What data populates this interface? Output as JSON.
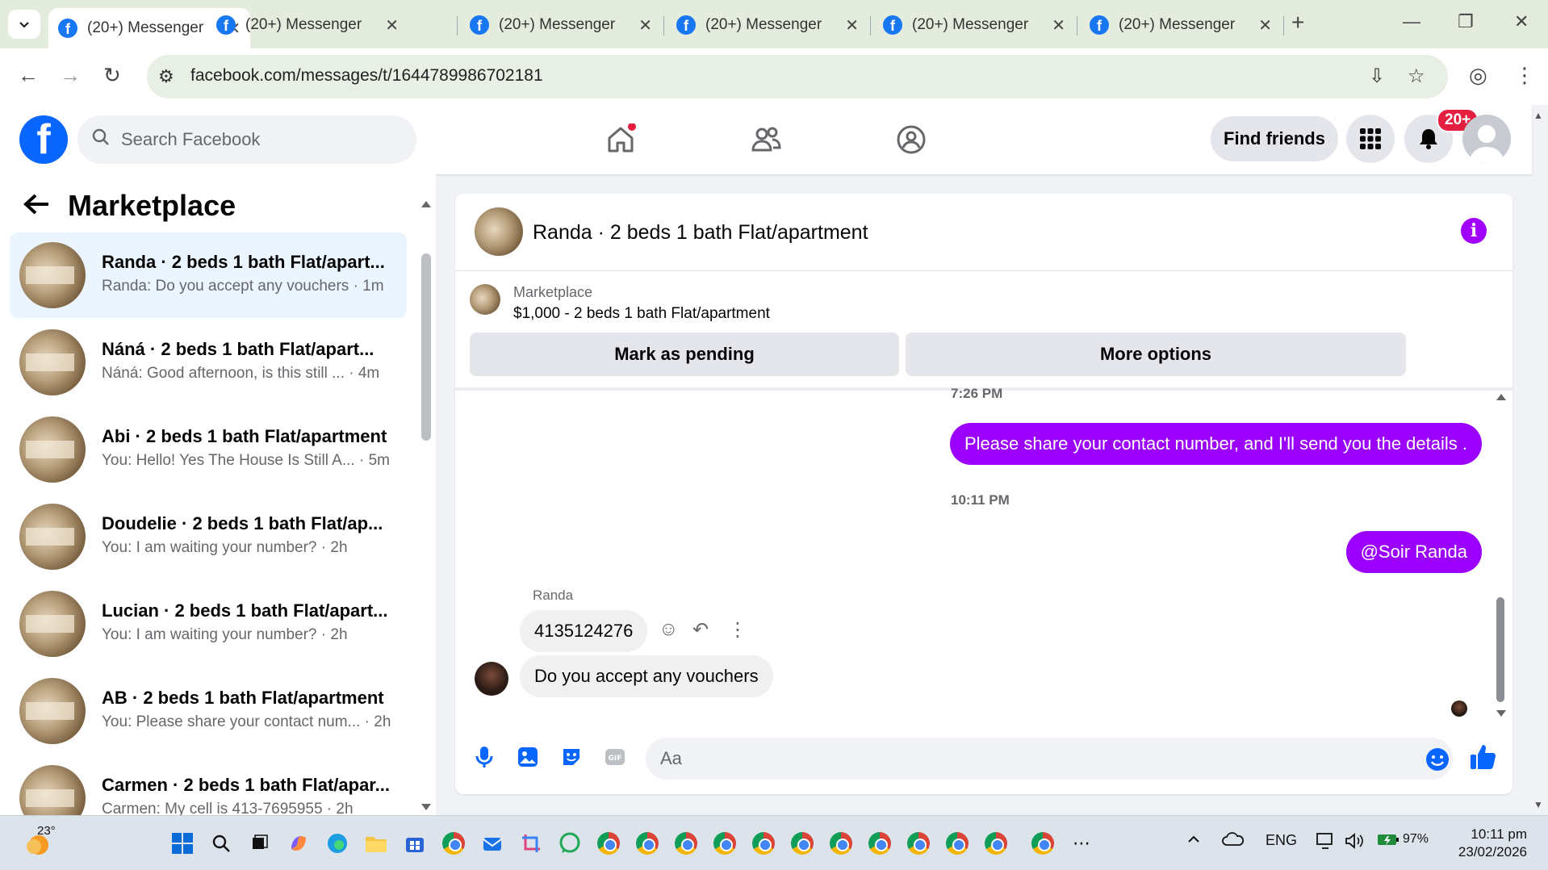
{
  "browser": {
    "tabs": [
      {
        "title": "(20+) Messenger |",
        "active": true
      },
      {
        "title": "(20+) Messenger |",
        "active": false
      },
      {
        "title": "(20+) Messenger |",
        "active": false
      },
      {
        "title": "(20+) Messenger |",
        "active": false
      },
      {
        "title": "(20+) Messenger |",
        "active": false
      },
      {
        "title": "(20+) Messenger |",
        "active": false
      }
    ],
    "url": "facebook.com/messages/t/1644789986702181"
  },
  "fb_header": {
    "search_placeholder": "Search Facebook",
    "find_friends_label": "Find friends",
    "notification_badge": "20+"
  },
  "sidebar": {
    "title": "Marketplace",
    "conversations": [
      {
        "name": "Randa · 2 beds 1 bath Flat/apart...",
        "preview": "Randa: Do you accept any vouchers · 1m",
        "active": true
      },
      {
        "name": "Náná · 2 beds 1 bath Flat/apart...",
        "preview": "Náná: Good afternoon, is this still ... · 4m",
        "active": false
      },
      {
        "name": "Abi · 2 beds 1 bath Flat/apartment",
        "preview": "You: Hello! Yes The House Is Still A... · 5m",
        "active": false
      },
      {
        "name": "Doudelie · 2 beds 1 bath Flat/ap...",
        "preview": "You: I am waiting your number? · 2h",
        "active": false
      },
      {
        "name": "Lucian · 2 beds 1 bath Flat/apart...",
        "preview": "You: I am waiting your number? · 2h",
        "active": false
      },
      {
        "name": "AB · 2 beds 1 bath Flat/apartment",
        "preview": "You: Please share your contact num... · 2h",
        "active": false
      },
      {
        "name": "Carmen · 2 beds 1 bath Flat/apar...",
        "preview": "Carmen: My cell is 413-7695955 · 2h",
        "active": false
      }
    ]
  },
  "chat": {
    "title": "Randa · 2 beds 1 bath Flat/apartment",
    "marketplace_label": "Marketplace",
    "listing": "$1,000 - 2 beds 1 bath Flat/apartment",
    "mark_pending_label": "Mark as pending",
    "more_options_label": "More options",
    "messages": {
      "time1": "7:26 PM",
      "out1": "Please share your contact number, and I'll send you the details .",
      "time2": "10:11 PM",
      "out2": "@Soir Randa",
      "sender": "Randa",
      "in1": "4135124276",
      "in2": "Do you accept any vouchers"
    },
    "composer_placeholder": "Aa"
  },
  "taskbar": {
    "temperature": "23°",
    "language": "ENG",
    "battery": "97%",
    "time": "10:11 pm",
    "date": "23/02/2026"
  },
  "colors": {
    "fb_blue": "#0866ff",
    "messenger_purple": "#9b00ff",
    "active_conv_bg": "#ebf5ff",
    "badge_red": "#e41e3f"
  }
}
